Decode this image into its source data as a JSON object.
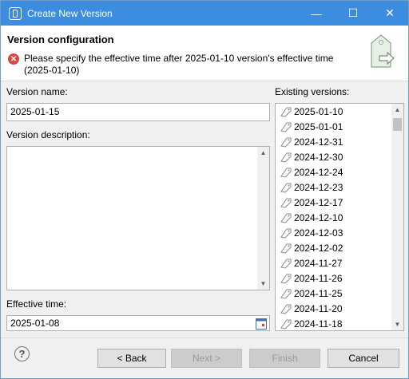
{
  "window": {
    "title": "Create New Version"
  },
  "header": {
    "title": "Version configuration",
    "error": "Please specify the effective time after 2025-01-10 version's effective time (2025-01-10)"
  },
  "form": {
    "version_name_label": "Version name:",
    "version_name_value": "2025-01-15",
    "description_label": "Version description:",
    "description_value": "",
    "effective_time_label": "Effective time:",
    "effective_time_value": "2025-01-08"
  },
  "existing": {
    "label": "Existing versions:",
    "items": [
      "2025-01-10",
      "2025-01-01",
      "2024-12-31",
      "2024-12-30",
      "2024-12-24",
      "2024-12-23",
      "2024-12-17",
      "2024-12-10",
      "2024-12-03",
      "2024-12-02",
      "2024-11-27",
      "2024-11-26",
      "2024-11-25",
      "2024-11-20",
      "2024-11-18"
    ]
  },
  "buttons": {
    "back": "< Back",
    "next": "Next >",
    "finish": "Finish",
    "cancel": "Cancel",
    "help": "?"
  }
}
